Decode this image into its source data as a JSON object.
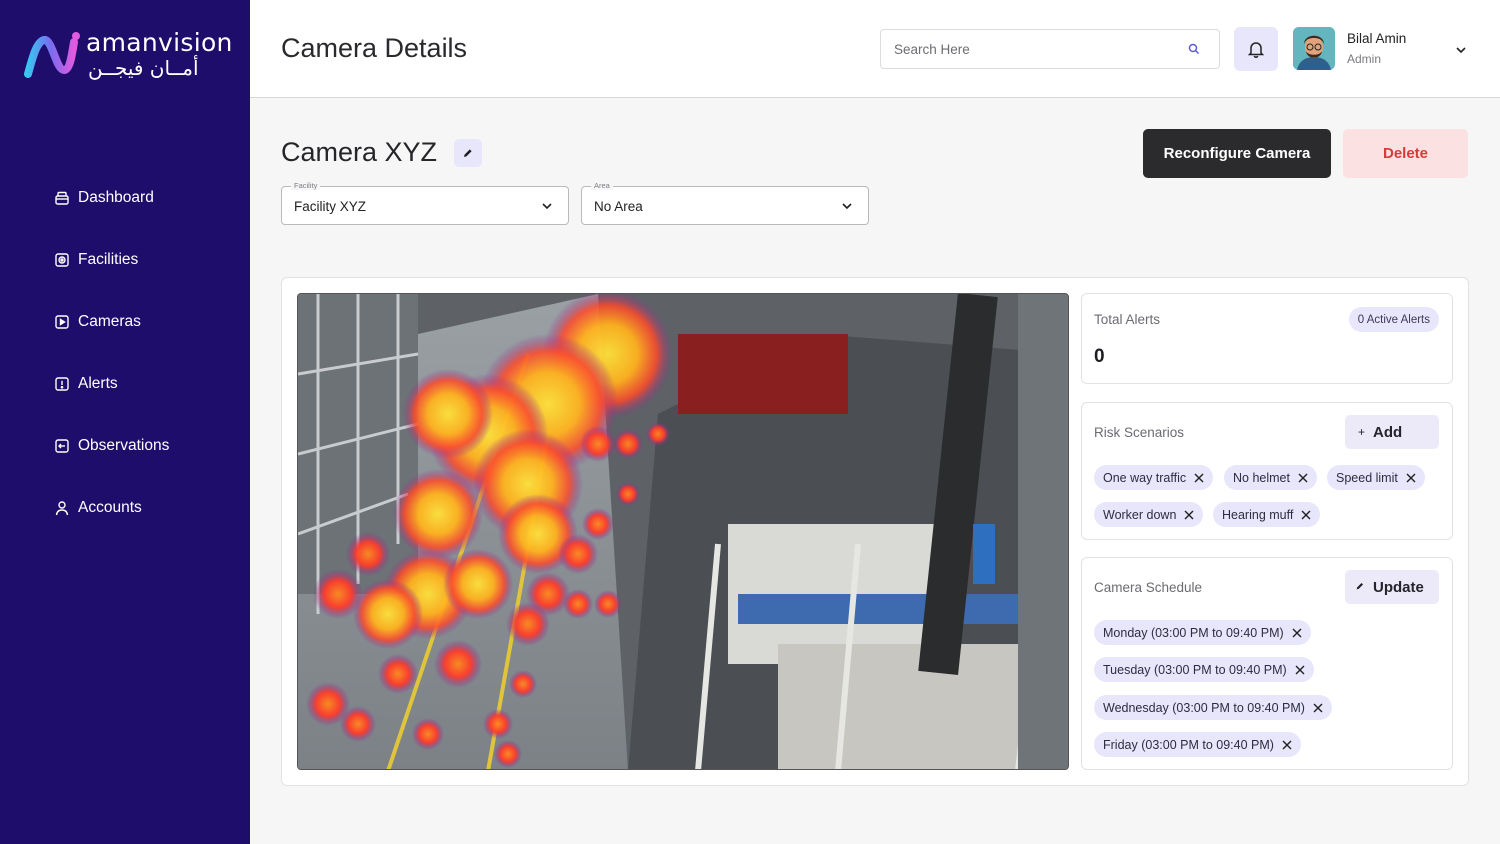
{
  "brand": {
    "name_en": "amanvision",
    "name_ar": "أمــان فيجــن"
  },
  "sidebar": {
    "items": [
      {
        "label": "Dashboard",
        "icon": "dashboard-icon"
      },
      {
        "label": "Facilities",
        "icon": "facilities-icon"
      },
      {
        "label": "Cameras",
        "icon": "cameras-icon"
      },
      {
        "label": "Alerts",
        "icon": "alerts-icon"
      },
      {
        "label": "Observations",
        "icon": "observations-icon"
      },
      {
        "label": "Accounts",
        "icon": "accounts-icon"
      }
    ]
  },
  "header": {
    "title": "Camera Details",
    "search_placeholder": "Search Here",
    "user": {
      "name": "Bilal Amin",
      "role": "Admin"
    }
  },
  "camera": {
    "name": "Camera XYZ",
    "reconfigure_label": "Reconfigure Camera",
    "delete_label": "Delete",
    "facility": {
      "label": "Facility",
      "value": "Facility XYZ"
    },
    "area": {
      "label": "Area",
      "value": "No Area"
    }
  },
  "alerts_panel": {
    "label": "Total Alerts",
    "badge": "0 Active Alerts",
    "total": "0"
  },
  "risk_panel": {
    "label": "Risk Scenarios",
    "add_label": "Add",
    "scenarios": [
      "One way traffic",
      "No helmet",
      "Speed limit",
      "Worker down",
      "Hearing muff"
    ]
  },
  "schedule_panel": {
    "label": "Camera Schedule",
    "update_label": "Update",
    "entries": [
      "Monday (03:00 PM to 09:40 PM)",
      "Tuesday (03:00 PM to 09:40 PM)",
      "Wednesday (03:00 PM to 09:40 PM)",
      "Friday (03:00 PM to 09:40 PM)"
    ]
  },
  "colors": {
    "sidebar_bg": "#1e0d6b",
    "accent_soft": "#e8e6fb",
    "danger": "#d43b3b",
    "danger_soft": "#fbe1e1",
    "dark_button": "#2b2b2d"
  }
}
